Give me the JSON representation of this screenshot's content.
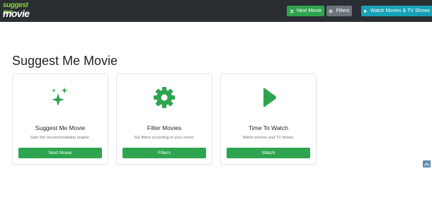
{
  "header": {
    "logo_line1": "suggest me",
    "logo_line2": "movie",
    "next_label": "Next Movie",
    "filters_label": "Filters",
    "watch_label": "Watch Movies & TV Shows"
  },
  "main": {
    "title": "Suggest Me Movie",
    "cards": [
      {
        "title": "Suggest Me Movie",
        "description": "Start the recommendation engine.",
        "button": "Next Movie",
        "icon": "sparkles-icon"
      },
      {
        "title": "Filter Movies",
        "description": "Set filters according to your mood.",
        "button": "Filters",
        "icon": "gear-icon"
      },
      {
        "title": "Time To Watch",
        "description": "Watch movies and TV shows.",
        "button": "Watch",
        "icon": "play-icon"
      }
    ]
  },
  "colors": {
    "topbar": "#2a2e33",
    "green": "#2ea44f",
    "gray": "#6c757d",
    "teal": "#17a2b8",
    "logo_green": "#8bd33a"
  }
}
